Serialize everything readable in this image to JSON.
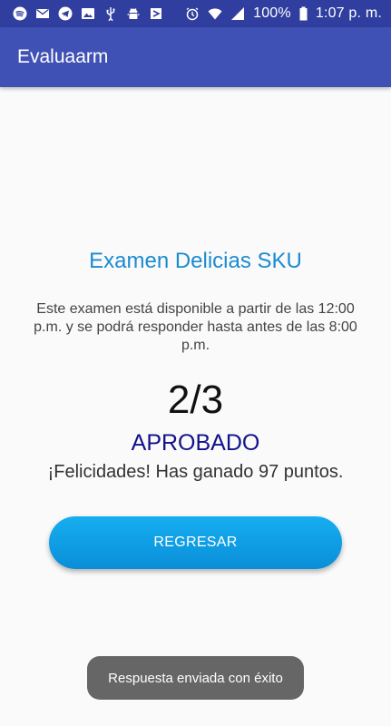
{
  "status_bar": {
    "left_icons": [
      "spotify-icon",
      "gmail-icon",
      "telegram-icon",
      "photo-icon",
      "usb-icon",
      "android-debug-icon",
      "download-icon"
    ],
    "right_icons": [
      "alarm-icon",
      "wifi-icon",
      "signal-icon",
      "battery-icon"
    ],
    "battery_text": "100%",
    "time_text": "1:07 p. m."
  },
  "app_bar": {
    "title": "Evaluaarm"
  },
  "exam": {
    "title": "Examen Delicias SKU",
    "description": "Este examen está disponible a partir de las 12:00 p.m. y se podrá responder hasta antes de las 8:00 p.m.",
    "score": "2/3",
    "result": "APROBADO",
    "congrats": "¡Felicidades! Has ganado 97 puntos."
  },
  "actions": {
    "back_label": "REGRESAR"
  },
  "toast": {
    "message": "Respuesta enviada con éxito"
  },
  "colors": {
    "status_bar": "#303f9f",
    "app_bar": "#3f51b5",
    "title_blue": "#1b8bd1",
    "result_navy": "#12128a",
    "button": "#0a9ce2"
  }
}
